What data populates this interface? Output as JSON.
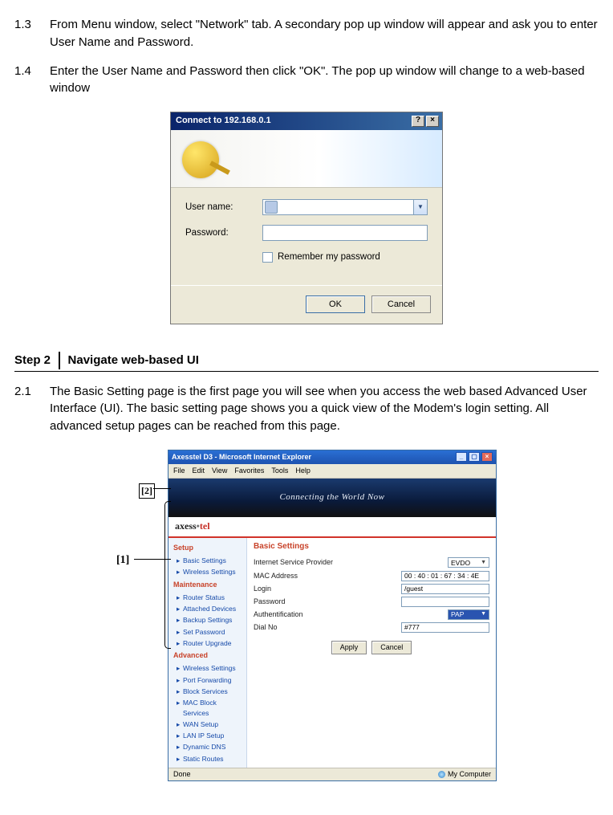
{
  "instr13": {
    "num": "1.3",
    "text": "From Menu window, select \"Network\" tab. A secondary pop up window will appear and ask you to enter User Name and Password."
  },
  "instr14": {
    "num": "1.4",
    "text": "Enter the User Name and Password then click \"OK\". The pop up window will change to a web-based window"
  },
  "dialog": {
    "title": "Connect to 192.168.0.1",
    "help_btn": "?",
    "close_btn": "×",
    "username_label": "User name:",
    "password_label": "Password:",
    "username_value": "",
    "password_value": "",
    "remember": "Remember my password",
    "ok": "OK",
    "cancel": "Cancel"
  },
  "step2": {
    "label": "Step 2",
    "title": "Navigate web-based UI"
  },
  "instr21": {
    "num": "2.1",
    "text": "The Basic Setting page is the first page you will see when you access the web based Advanced User Interface (UI). The basic setting page shows you a quick view of the Modem's login setting. All advanced setup pages can be reached from this page."
  },
  "callouts": {
    "one": "[1]",
    "two": "[2]"
  },
  "browser": {
    "window_title": "Axesstel D3 - Microsoft Internet Explorer",
    "menus": [
      "File",
      "Edit",
      "View",
      "Favorites",
      "Tools",
      "Help"
    ],
    "banner_text": "Connecting the World Now",
    "logo_a": "axess",
    "logo_b": "tel",
    "sidebar": {
      "groups": [
        {
          "header": "Setup",
          "items": [
            "Basic Settings",
            "Wireless Settings"
          ]
        },
        {
          "header": "Maintenance",
          "items": [
            "Router Status",
            "Attached Devices",
            "Backup Settings",
            "Set Password",
            "Router Upgrade"
          ]
        },
        {
          "header": "Advanced",
          "items": [
            "Wireless Settings",
            "Port Forwarding",
            "Block Services",
            "MAC Block Services",
            "WAN Setup",
            "LAN IP Setup",
            "Dynamic DNS",
            "Static Routes"
          ]
        }
      ]
    },
    "main": {
      "title": "Basic Settings",
      "rows": [
        {
          "label": "Internet Service Provider",
          "type": "select",
          "value": "EVDO"
        },
        {
          "label": "MAC Address",
          "type": "text",
          "value": "00 : 40 : 01 : 67 : 34 : 4E"
        },
        {
          "label": "Login",
          "type": "text",
          "value": "/guest"
        },
        {
          "label": "Password",
          "type": "text",
          "value": ""
        },
        {
          "label": "Authentification",
          "type": "select-blue",
          "value": "PAP"
        },
        {
          "label": "Dial No",
          "type": "text",
          "value": "#777"
        }
      ],
      "apply": "Apply",
      "cancel": "Cancel"
    },
    "status": {
      "done": "Done",
      "zone": "My Computer"
    }
  }
}
